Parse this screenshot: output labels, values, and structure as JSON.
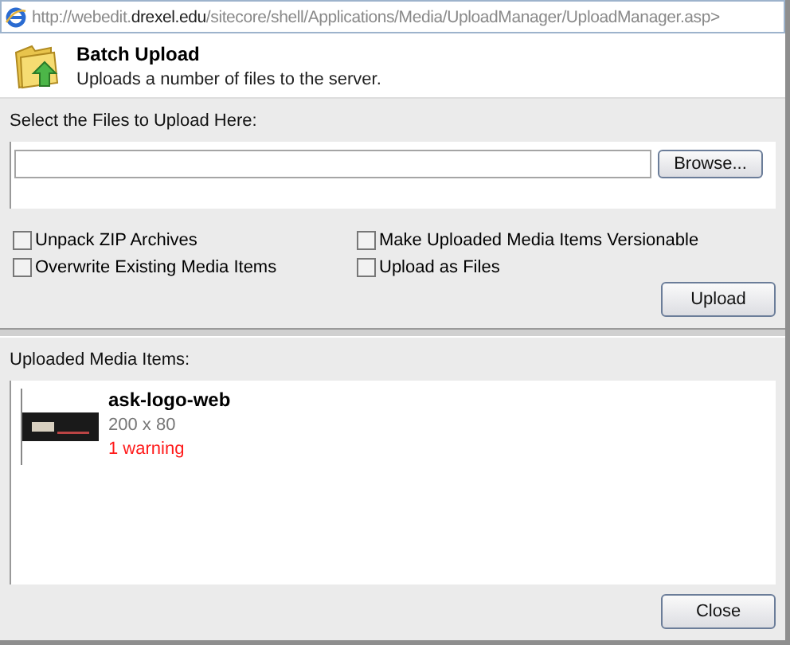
{
  "address_bar": {
    "prefix": "http://webedit.",
    "domain": "drexel.edu",
    "path": "/sitecore/shell/Applications/Media/UploadManager/UploadManager.asp>"
  },
  "header": {
    "title": "Batch Upload",
    "subtitle": "Uploads a number of files to the server."
  },
  "select_section": {
    "label": "Select the Files to Upload Here:",
    "browse_button": "Browse..."
  },
  "options": [
    {
      "label": "Unpack ZIP Archives",
      "checked": false
    },
    {
      "label": "Make Uploaded Media Items Versionable",
      "checked": false
    },
    {
      "label": "Overwrite Existing Media Items",
      "checked": false
    },
    {
      "label": "Upload as Files",
      "checked": false
    }
  ],
  "upload_button": "Upload",
  "uploaded_section": {
    "label": "Uploaded Media Items:",
    "items": [
      {
        "name": "ask-logo-web",
        "dimensions": "200 x 80",
        "status": "1 warning",
        "kind": "warning"
      }
    ]
  },
  "close_button": "Close"
}
